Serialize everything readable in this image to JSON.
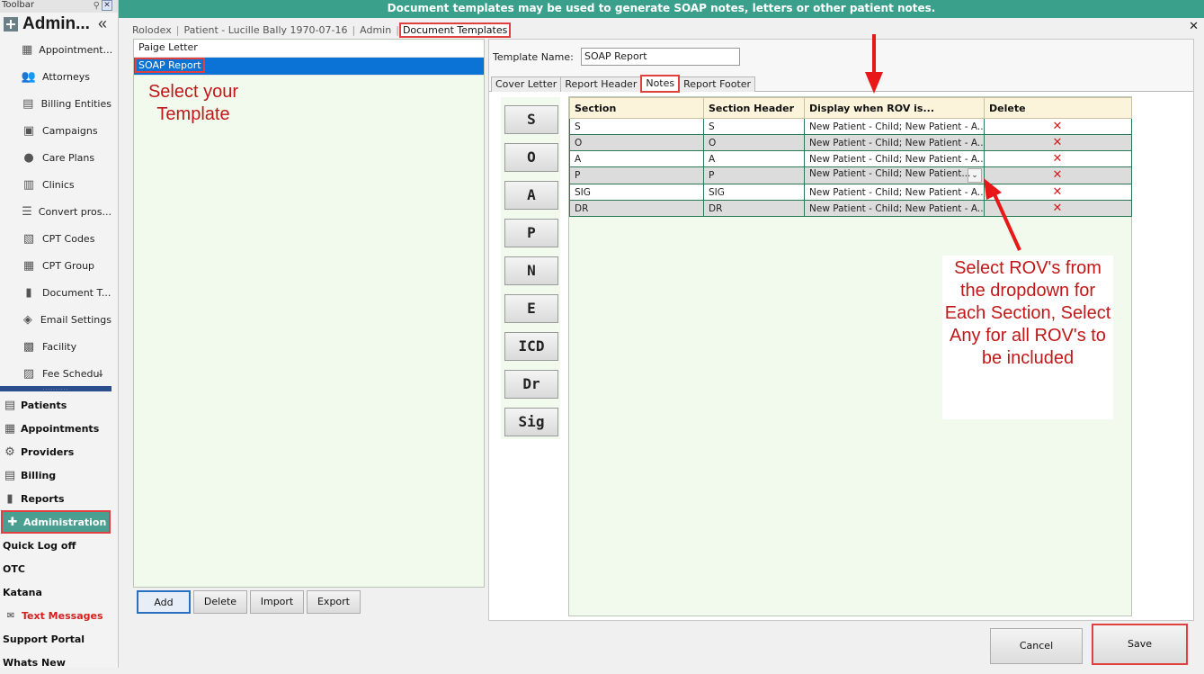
{
  "toolbar": {
    "title": "Toolbar",
    "section_title": "Admin...",
    "collapse_glyph": "«"
  },
  "admin_items": [
    {
      "label": "Appointment...",
      "icon": "calendar-icon"
    },
    {
      "label": "Attorneys",
      "icon": "people-icon"
    },
    {
      "label": "Billing Entities",
      "icon": "billing-icon"
    },
    {
      "label": "Campaigns",
      "icon": "campaign-icon"
    },
    {
      "label": "Care Plans",
      "icon": "person-icon"
    },
    {
      "label": "Clinics",
      "icon": "building-icon"
    },
    {
      "label": "Convert pros...",
      "icon": "list-icon"
    },
    {
      "label": "CPT Codes",
      "icon": "cpt-icon"
    },
    {
      "label": "CPT Group",
      "icon": "grid-icon"
    },
    {
      "label": "Document T...",
      "icon": "chart-icon"
    },
    {
      "label": "Email Settings",
      "icon": "tag-icon"
    },
    {
      "label": "Facility",
      "icon": "facility-icon"
    },
    {
      "label": "Fee Schedul",
      "icon": "fee-icon"
    }
  ],
  "main_nav": [
    {
      "label": "Patients",
      "icon": "patients-icon"
    },
    {
      "label": "Appointments",
      "icon": "calendar-icon"
    },
    {
      "label": "Providers",
      "icon": "gear-icon"
    },
    {
      "label": "Billing",
      "icon": "billing-icon"
    },
    {
      "label": "Reports",
      "icon": "chart-icon"
    },
    {
      "label": "Administration",
      "icon": "admin-icon"
    },
    {
      "label": "Quick Log off",
      "icon": ""
    },
    {
      "label": "OTC",
      "icon": ""
    },
    {
      "label": "Katana",
      "icon": ""
    },
    {
      "label": "Text Messages",
      "icon": "mail-icon"
    },
    {
      "label": "Support Portal",
      "icon": ""
    },
    {
      "label": "Whats New",
      "icon": ""
    }
  ],
  "banner": "Document templates may be used to generate SOAP notes, letters or other patient notes.",
  "breadcrumb": [
    "Rolodex",
    "Patient - Lucille Bally 1970-07-16",
    "Admin",
    "Document Templates"
  ],
  "templates": [
    "Paige Letter",
    "SOAP Report"
  ],
  "annotation_left": "Select your Template",
  "annotation_right": "Select ROV's from the dropdown for Each Section, Select Any for all ROV's to be included",
  "list_buttons": [
    "Add",
    "Delete",
    "Import",
    "Export"
  ],
  "template_name_label": "Template Name:",
  "template_name_value": "SOAP Report",
  "tabs": [
    "Cover Letter",
    "Report Header",
    "Notes",
    "Report Footer"
  ],
  "section_buttons": [
    "S",
    "O",
    "A",
    "P",
    "N",
    "E",
    "ICD",
    "Dr",
    "Sig"
  ],
  "grid": {
    "headers": [
      "Section",
      "Section Header",
      "Display when ROV is...",
      "Delete"
    ],
    "rows": [
      {
        "section": "S",
        "header": "S",
        "rov": "New Patient - Child; New Patient - A..."
      },
      {
        "section": "O",
        "header": "O",
        "rov": "New Patient - Child; New Patient - A..."
      },
      {
        "section": "A",
        "header": "A",
        "rov": "New Patient - Child; New Patient - A..."
      },
      {
        "section": "P",
        "header": "P",
        "rov": "New Patient - Child; New Patient..."
      },
      {
        "section": "SIG",
        "header": "SIG",
        "rov": "New Patient - Child; New Patient - A..."
      },
      {
        "section": "DR",
        "header": "DR",
        "rov": "New Patient - Child; New Patient - A..."
      }
    ]
  },
  "footer_buttons": {
    "cancel": "Cancel",
    "save": "Save"
  },
  "colors": {
    "banner": "#3aa08c",
    "accent_red": "#e04040",
    "selection": "#0b72d6",
    "panel_green": "#f2faee"
  }
}
